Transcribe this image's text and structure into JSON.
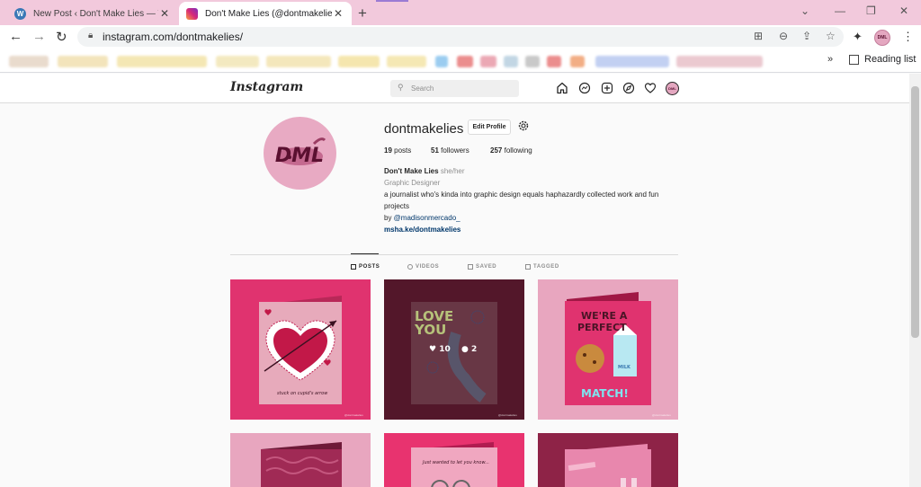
{
  "browser": {
    "tabs": [
      {
        "title": "New Post ‹ Don't Make Lies — W",
        "active": false
      },
      {
        "title": "Don't Make Lies (@dontmakelies",
        "active": true
      }
    ],
    "new_tab_label": "+",
    "url": "instagram.com/dontmakelies/",
    "reading_list_label": "Reading list",
    "bookmarks_more": "»",
    "profile_initials": "DML"
  },
  "instagram": {
    "logo": "Instagram",
    "search_placeholder": "Search",
    "nav_avatar_initials": "DML",
    "profile": {
      "username": "dontmakelies",
      "edit_profile_label": "Edit Profile",
      "posts_count": "19",
      "posts_label": "posts",
      "followers_count": "51",
      "followers_label": "followers",
      "following_count": "257",
      "following_label": "following",
      "display_name": "Don't Make Lies",
      "pronouns": "she/her",
      "category": "Graphic Designer",
      "bio_line1": "a journalist who's kinda into graphic design equals haphazardly collected work and fun projects",
      "by_prefix": "by ",
      "by_handle": "@madisonmercado_",
      "website": "msha.ke/dontmakelies",
      "avatar_text": "DML"
    },
    "tabs": [
      {
        "label": "POSTS",
        "active": true
      },
      {
        "label": "VIDEOS",
        "active": false
      },
      {
        "label": "SAVED",
        "active": false
      },
      {
        "label": "TAGGED",
        "active": false
      }
    ],
    "posts": [
      {
        "caption": "stuck on cupid's arrow",
        "bg": "#e0336f",
        "card": "#e7aabb",
        "watermark": "@dontmakelies"
      },
      {
        "headline": "LOVE YOU",
        "likes": "10",
        "comments": "2",
        "bg": "#6a1f37",
        "card": "#7a3a4a",
        "watermark": "@dontmakelies"
      },
      {
        "headline_1": "WE'RE A",
        "headline_2": "PERFECT",
        "match": "MATCH!",
        "milk": "MILK",
        "bg": "#e8a6bf",
        "card": "#e0336f",
        "watermark": "@dontmakelies"
      },
      {
        "bg": "#e8a6bf",
        "card": "#a02a55"
      },
      {
        "caption": "Just wanted to let you know...",
        "bg": "#e8336f",
        "card": "#f0a7c0"
      },
      {
        "bg": "#8e2347",
        "card": "#e887ad"
      }
    ]
  }
}
